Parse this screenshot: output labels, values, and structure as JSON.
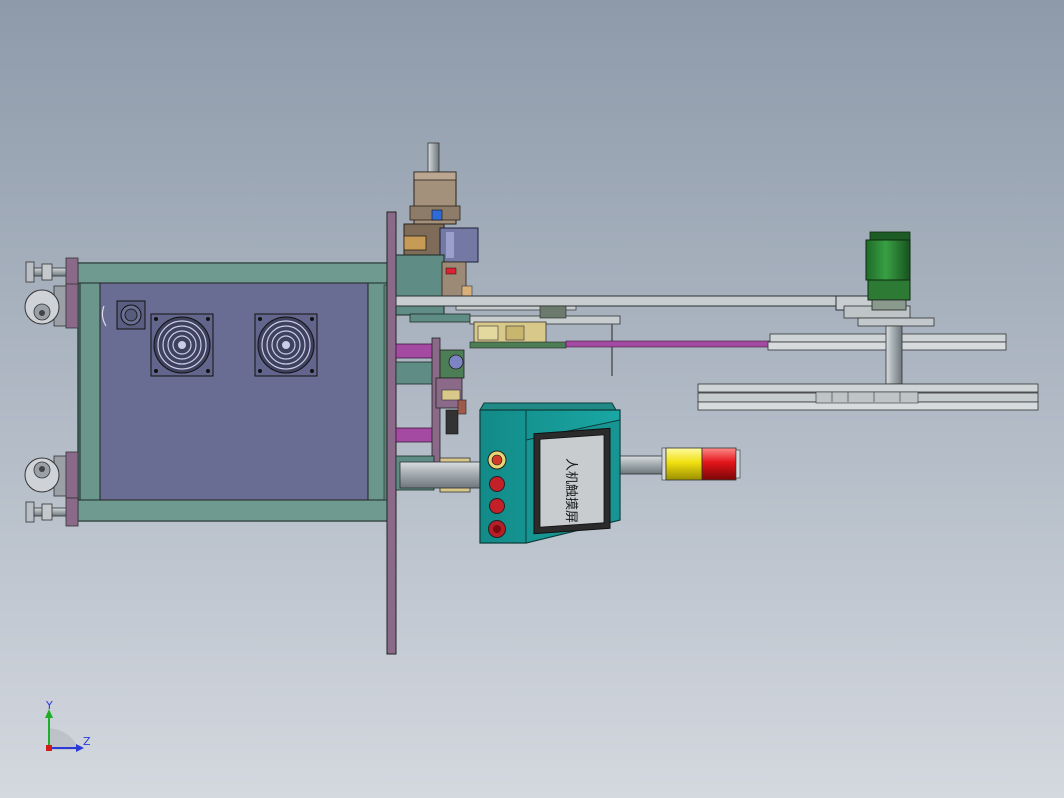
{
  "hmi": {
    "screen_text": "人机触摸屏"
  },
  "triad": {
    "y_label": "Y",
    "z_label": "Z"
  },
  "colors": {
    "frame": "#5f8c84",
    "panel": "#696d93",
    "plate": "#8b6a89",
    "hmi_body": "#1d9a98",
    "motor": "#2e8a36",
    "rod": "#a54aa2",
    "lamp_yellow": "#f0e010",
    "lamp_red": "#e21418"
  }
}
